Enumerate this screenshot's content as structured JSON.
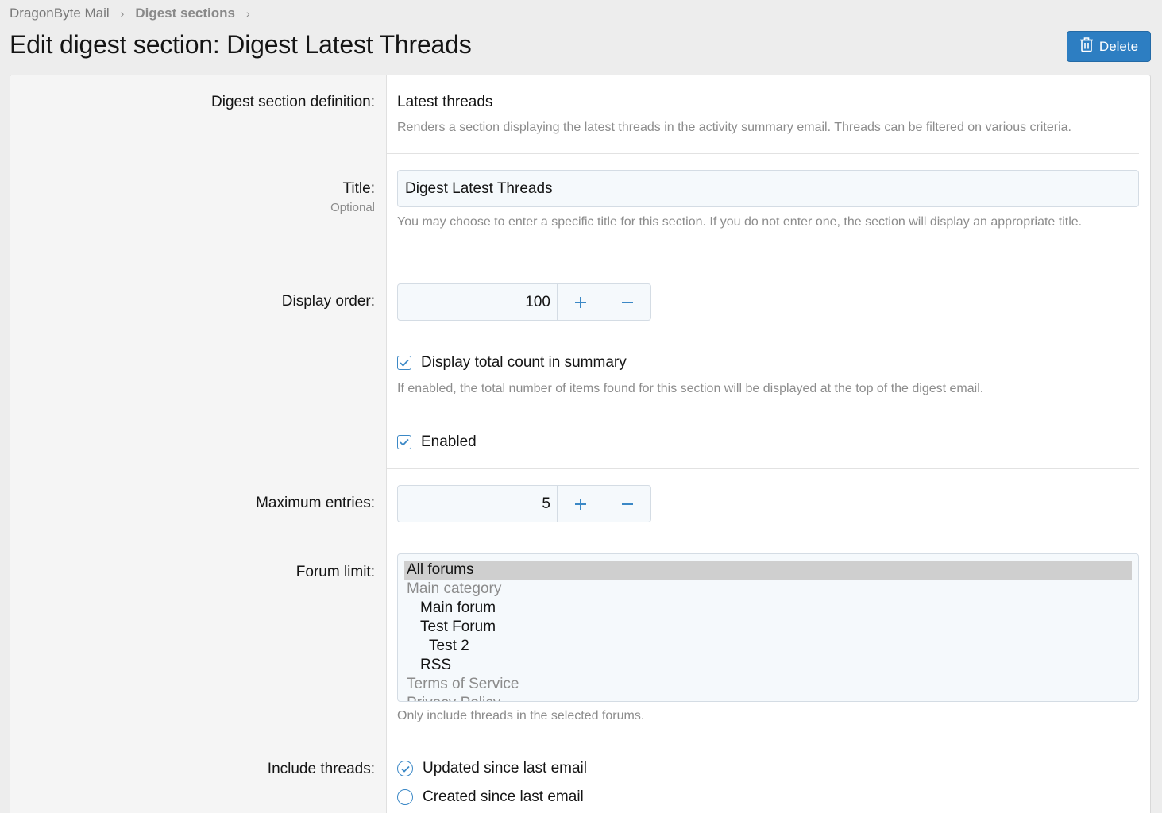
{
  "breadcrumb": {
    "items": [
      "DragonByte Mail",
      "Digest sections"
    ]
  },
  "page": {
    "title": "Edit digest section: Digest Latest Threads",
    "delete_label": "Delete"
  },
  "colors": {
    "accent": "#2d7ec2",
    "label_bg": "#f5f5f5",
    "input_bg": "#f5f9fc"
  },
  "definition": {
    "label": "Digest section definition:",
    "value": "Latest threads",
    "description": "Renders a section displaying the latest threads in the activity summary email. Threads can be filtered on various criteria."
  },
  "title_field": {
    "label": "Title:",
    "hint": "Optional",
    "value": "Digest Latest Threads",
    "explain": "You may choose to enter a specific title for this section. If you do not enter one, the section will display an appropriate title."
  },
  "display_order": {
    "label": "Display order:",
    "value": "100",
    "plus": "+",
    "minus": "−"
  },
  "total_count": {
    "label": "Display total count in summary",
    "checked": true,
    "explain": "If enabled, the total number of items found for this section will be displayed at the top of the digest email."
  },
  "enabled": {
    "label": "Enabled",
    "checked": true
  },
  "max_entries": {
    "label": "Maximum entries:",
    "value": "5",
    "plus": "+",
    "minus": "−"
  },
  "forum_limit": {
    "label": "Forum limit:",
    "options": [
      {
        "text": "All forums",
        "selected": true,
        "kind": "l0"
      },
      {
        "text": "Main category",
        "selected": false,
        "kind": "grp"
      },
      {
        "text": "Main forum",
        "selected": false,
        "kind": "l1"
      },
      {
        "text": "Test Forum",
        "selected": false,
        "kind": "l1"
      },
      {
        "text": "Test 2",
        "selected": false,
        "kind": "l2"
      },
      {
        "text": "RSS",
        "selected": false,
        "kind": "l1"
      },
      {
        "text": "Terms of Service",
        "selected": false,
        "kind": "grp"
      },
      {
        "text": "Privacy Policy",
        "selected": false,
        "kind": "grp"
      }
    ],
    "explain": "Only include threads in the selected forums."
  },
  "include_threads": {
    "label": "Include threads:",
    "options": [
      {
        "text": "Updated since last email",
        "selected": true
      },
      {
        "text": "Created since last email",
        "selected": false
      }
    ]
  }
}
